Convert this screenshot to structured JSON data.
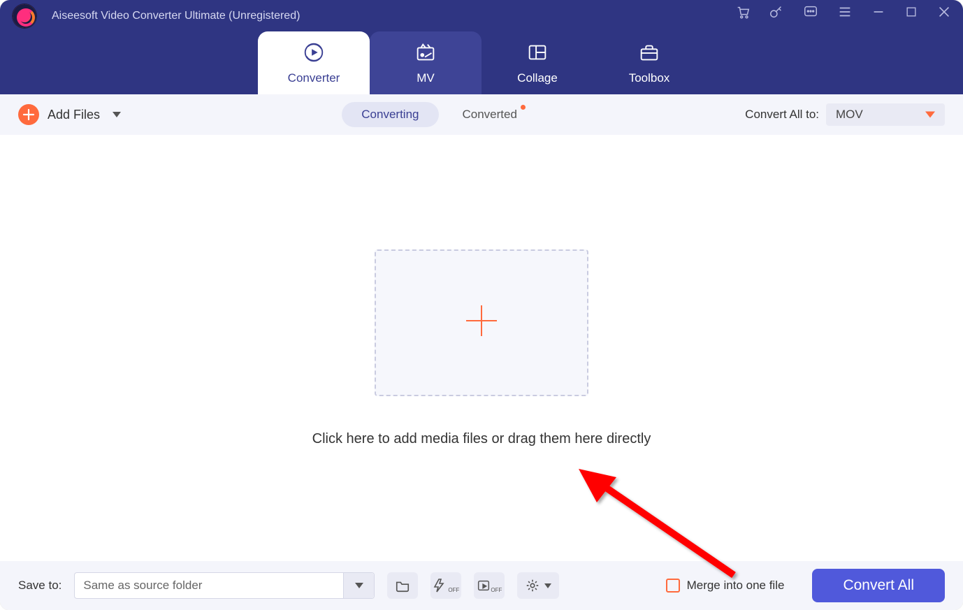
{
  "app_title": "Aiseesoft Video Converter Ultimate (Unregistered)",
  "tabs": {
    "converter": "Converter",
    "mv": "MV",
    "collage": "Collage",
    "toolbox": "Toolbox"
  },
  "toolbar": {
    "add_files": "Add Files",
    "converting": "Converting",
    "converted": "Converted",
    "convert_all_to_label": "Convert All to:",
    "format_selected": "MOV"
  },
  "drop": {
    "hint": "Click here to add media files or drag them here directly"
  },
  "footer": {
    "save_to_label": "Save to:",
    "save_path": "Same as source folder",
    "merge_label": "Merge into one file",
    "convert_button": "Convert All"
  }
}
